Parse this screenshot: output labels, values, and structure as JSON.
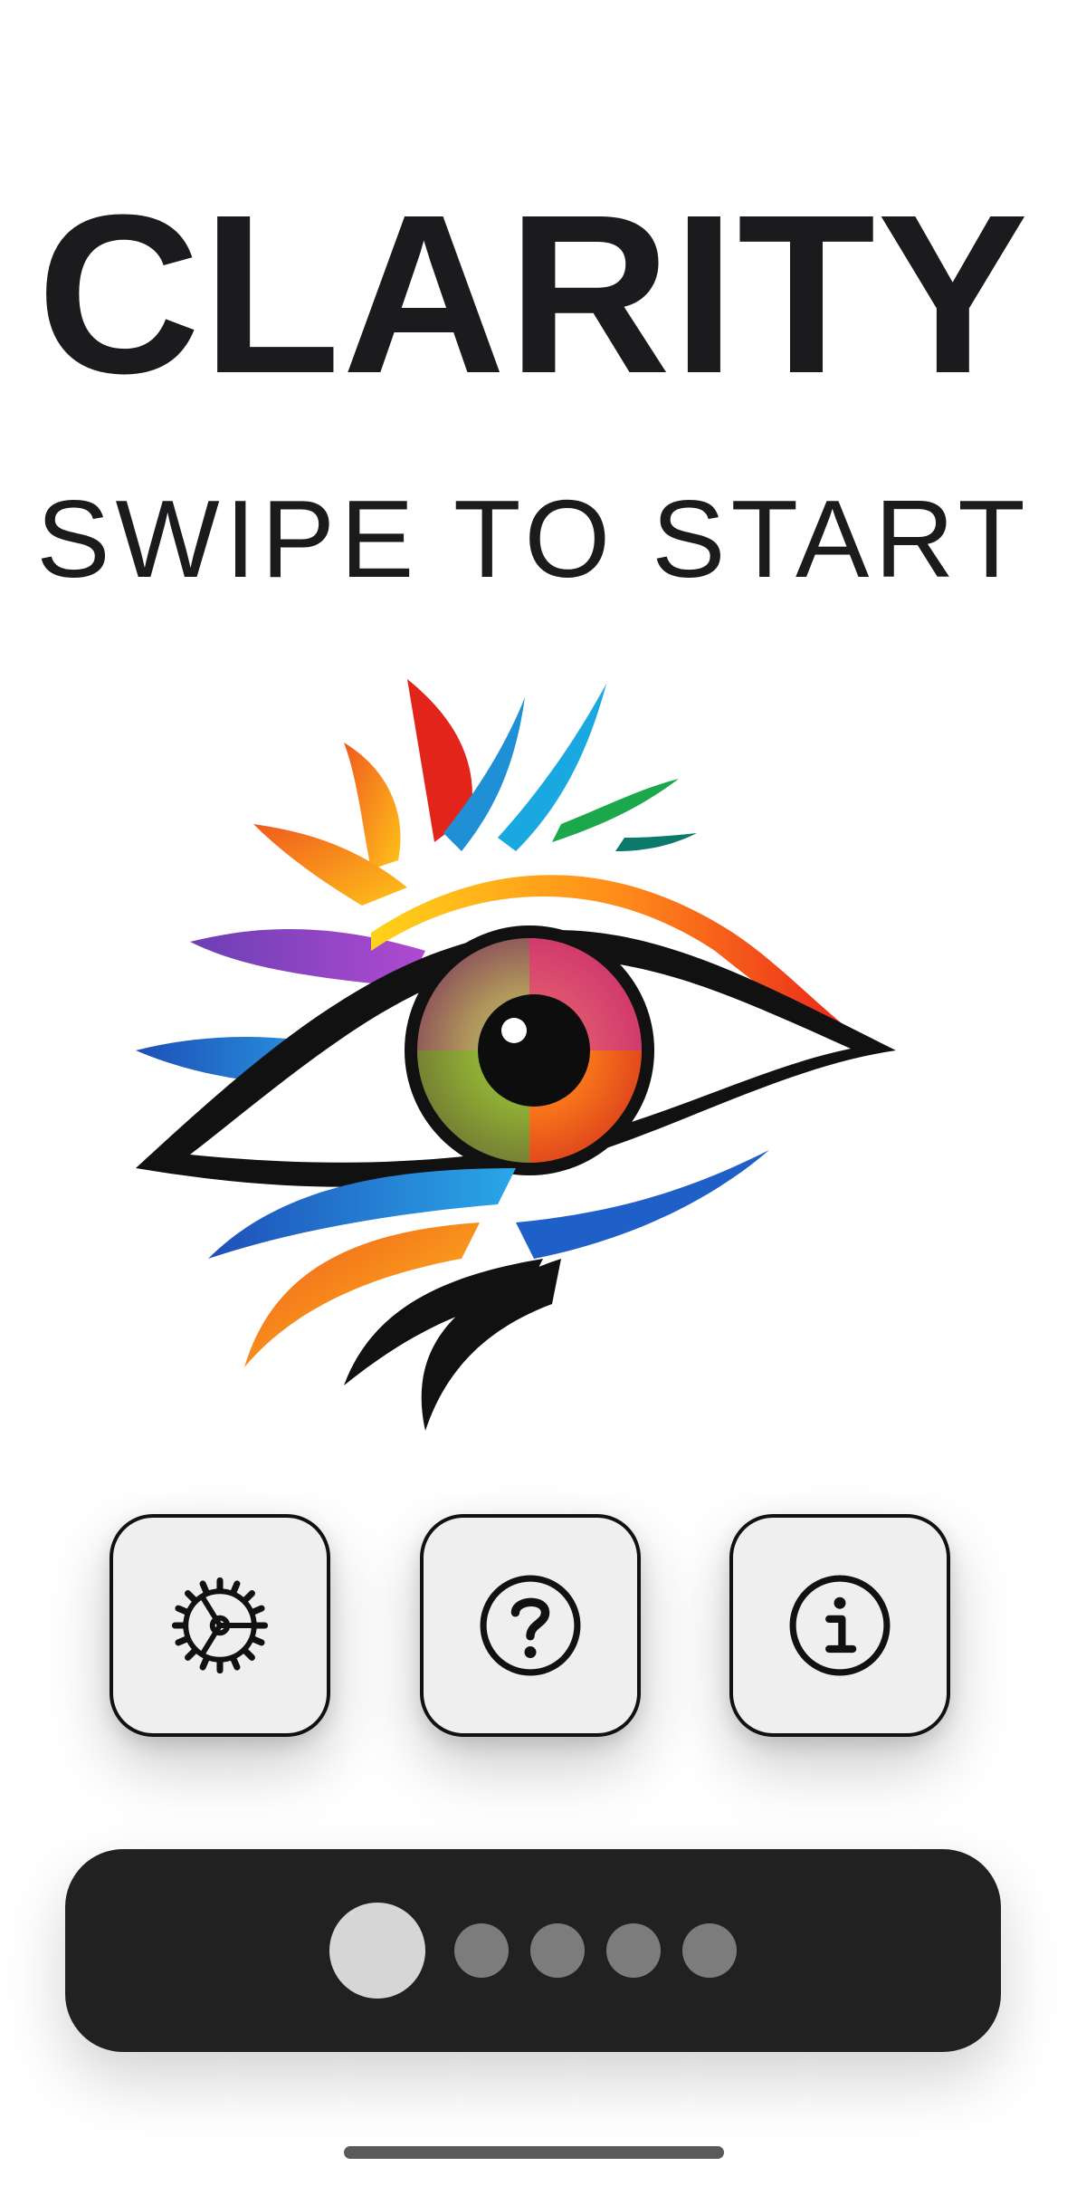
{
  "app": {
    "title": "CLARITY",
    "subtitle": "SWIPE TO START"
  },
  "logo": {
    "icon": "rainbow-eye-logo"
  },
  "actions": [
    {
      "id": "settings",
      "icon": "gear-icon"
    },
    {
      "id": "help",
      "icon": "question-circle-icon"
    },
    {
      "id": "info",
      "icon": "info-circle-icon"
    }
  ],
  "pager": {
    "total_pages": 5,
    "current_page": 1
  },
  "colors": {
    "text": "#1b1a1d",
    "button_bg": "#efefef",
    "pager_bg": "#212121",
    "dot_active": "#d6d6d6",
    "dot_inactive": "#7c7c7c"
  }
}
